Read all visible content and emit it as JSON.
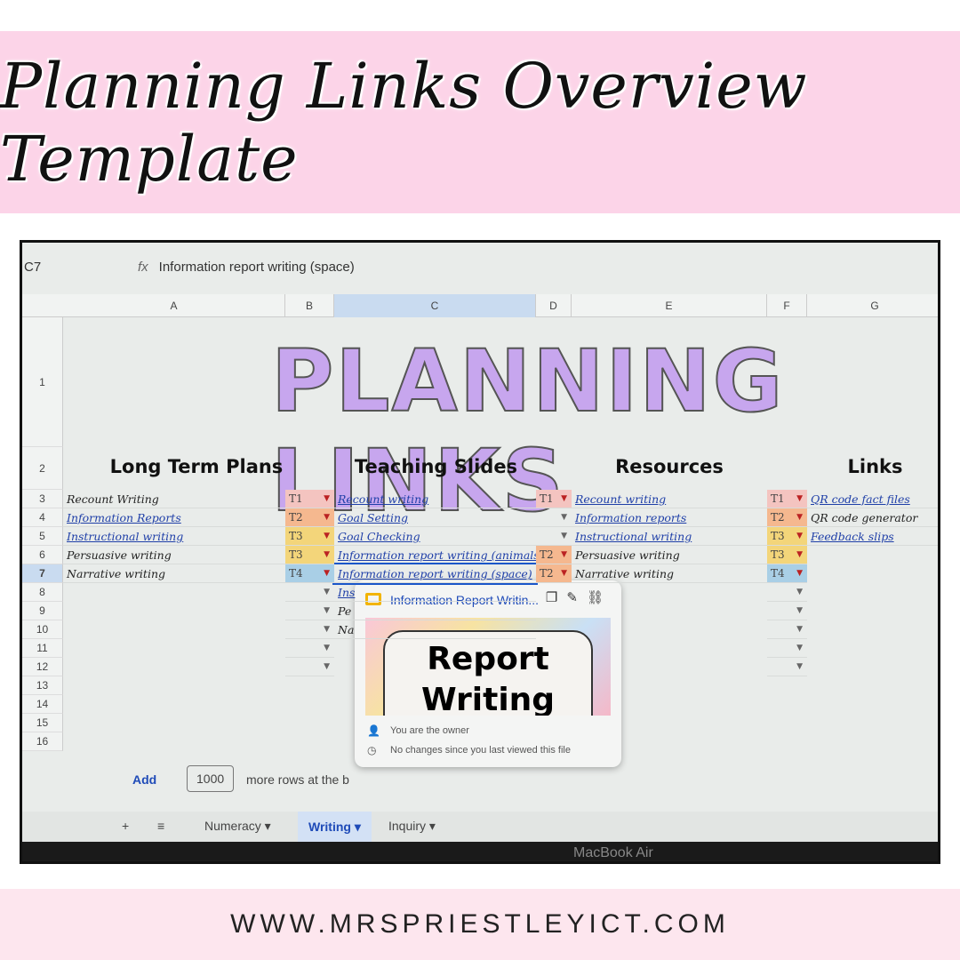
{
  "banner": {
    "title": "Planning Links Overview Template",
    "url": "WWW.MRSPRIESTLEYICT.COM"
  },
  "sheet": {
    "cell_ref": "C7",
    "fx": "fx",
    "formula": "Information report writing (space)",
    "columns": [
      "A",
      "B",
      "C",
      "D",
      "E",
      "F",
      "G"
    ],
    "rows": [
      "1",
      "2",
      "3",
      "4",
      "5",
      "6",
      "7",
      "8",
      "9",
      "10",
      "11",
      "12",
      "13",
      "14",
      "15",
      "16"
    ],
    "big_title": "PLANNING LINKS",
    "headers": {
      "long_term": "Long Term Plans",
      "slides": "Teaching Slides",
      "resources": "Resources",
      "links": "Links"
    },
    "col_a": [
      {
        "t": "Recount Writing",
        "link": false
      },
      {
        "t": "Information Reports",
        "link": true
      },
      {
        "t": "Instructional writing",
        "link": true
      },
      {
        "t": "Persuasive writing",
        "link": false
      },
      {
        "t": "Narrative writing",
        "link": false
      }
    ],
    "col_b": [
      "T1",
      "T2",
      "T3",
      "T3",
      "T4"
    ],
    "col_c": [
      {
        "t": "Recount writing",
        "link": true
      },
      {
        "t": "Goal Setting",
        "link": true
      },
      {
        "t": "Goal Checking",
        "link": true
      },
      {
        "t": "Information report writing (animals)",
        "link": true
      },
      {
        "t": "Information report writing (space)",
        "link": true
      },
      {
        "t": "Ins",
        "link": true
      },
      {
        "t": "Pe",
        "link": false
      },
      {
        "t": "Na",
        "link": false
      }
    ],
    "col_d": [
      "T1",
      "",
      "",
      "T2",
      "T2"
    ],
    "col_e": [
      {
        "t": "Recount writing",
        "link": true
      },
      {
        "t": "Information reports",
        "link": true
      },
      {
        "t": "Instructional writing",
        "link": true
      },
      {
        "t": "Persuasive writing",
        "link": false
      },
      {
        "t": "Narrative writing",
        "link": false
      }
    ],
    "col_f": [
      "T1",
      "T2",
      "T3",
      "T3",
      "T4"
    ],
    "col_g": [
      {
        "t": "QR code fact files",
        "link": true
      },
      {
        "t": "QR code generator",
        "link": false
      },
      {
        "t": "Feedback slips",
        "link": true
      }
    ],
    "tag_colors": {
      "T1": "#f4c4c0",
      "T2": "#f5b88f",
      "T3": "#f3d57a",
      "T4": "#a9cfe6"
    }
  },
  "popup": {
    "title": "Information Report Writin...",
    "thumb_text": "Report Writing",
    "owner": "You are the owner",
    "changes": "No changes since you last viewed this file",
    "icons": [
      "copy-icon",
      "edit-icon",
      "unlink-icon"
    ]
  },
  "add_rows": {
    "button": "Add",
    "value": "1000",
    "suffix": "more rows at the b"
  },
  "tabs": {
    "add": "+",
    "menu": "≡",
    "items": [
      "Numeracy",
      "Writing",
      "Inquiry"
    ],
    "active": "Writing"
  },
  "bezel": "MacBook Air"
}
